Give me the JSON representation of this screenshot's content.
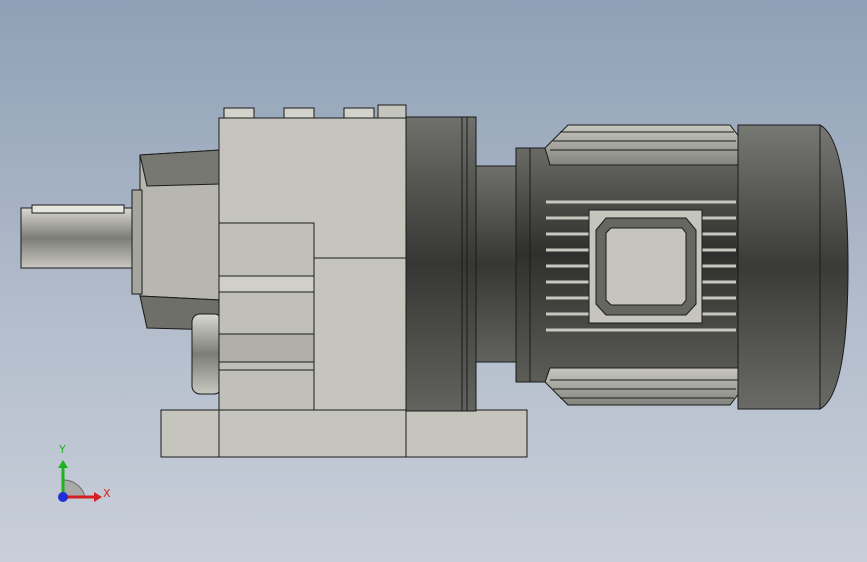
{
  "viewport": {
    "background_top": "#8fa0b6",
    "background_bottom": "#c9cfda"
  },
  "model": {
    "name": "gear-motor",
    "colors": {
      "housing": "#c5c5bd",
      "motor_dark": "#4f504c",
      "outline": "#1a1a1a"
    }
  },
  "triad": {
    "x_label": "X",
    "y_label": "Y",
    "colors": {
      "x": "#d42020",
      "y": "#1fb21f",
      "z": "#2030d8"
    }
  }
}
